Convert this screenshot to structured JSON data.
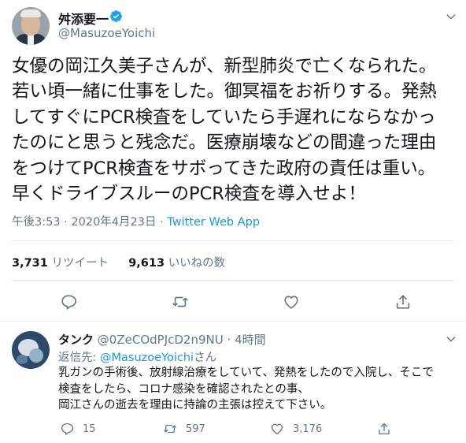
{
  "main_tweet": {
    "display_name": "舛添要一",
    "handle": "@MasuzoeYoichi",
    "text_lines": [
      "女優の岡江久美子さんが、新型肺炎で亡くなられた。",
      "若い頃一緒に仕事をした。御冥福をお祈りする。発熱",
      "してすぐにPCR検査をしていたら手遅れにならなかっ",
      "たのにと思うと残念だ。医療崩壊などの間違った理由",
      "をつけてPCR検査をサボってきた政府の責任は重い。",
      "早くドライブスルーのPCR検査を導入せよ！"
    ],
    "time": "午後3:53",
    "date": "2020年4月23日",
    "separator": "·",
    "source_app": "Twitter Web App",
    "retweets_count": "3,731",
    "retweets_label": "リツイート",
    "likes_count": "9,613",
    "likes_label": "いいねの数"
  },
  "reply_tweet": {
    "display_name": "タンク",
    "handle": "@0ZeCOdPJcD2n9NU",
    "separator": "·",
    "age": "4時間",
    "replying_prefix": "返信先: ",
    "replying_to": "@MasuzoeYoichi",
    "replying_suffix": "さん",
    "text_lines": [
      "乳ガンの手術後、放射線治療をしていて、発熱をしたので入院し、そこで",
      "検査をしたら、コロナ感染を確認されたとの事、",
      "岡江さんの逝去を理由に持論の主張は控えて下さい。"
    ],
    "reply_count": "15",
    "retweet_count": "597",
    "like_count": "3,176"
  },
  "icons": {
    "verified": "verified-badge-icon",
    "caret": "chevron-down-icon",
    "reply": "reply-bubble-icon",
    "retweet": "retweet-arrows-icon",
    "like": "heart-icon",
    "share": "share-upload-icon"
  },
  "colors": {
    "text_primary": "#14171a",
    "text_secondary": "#657786",
    "link_blue": "#1b95e0",
    "border": "#e6ecf0"
  }
}
